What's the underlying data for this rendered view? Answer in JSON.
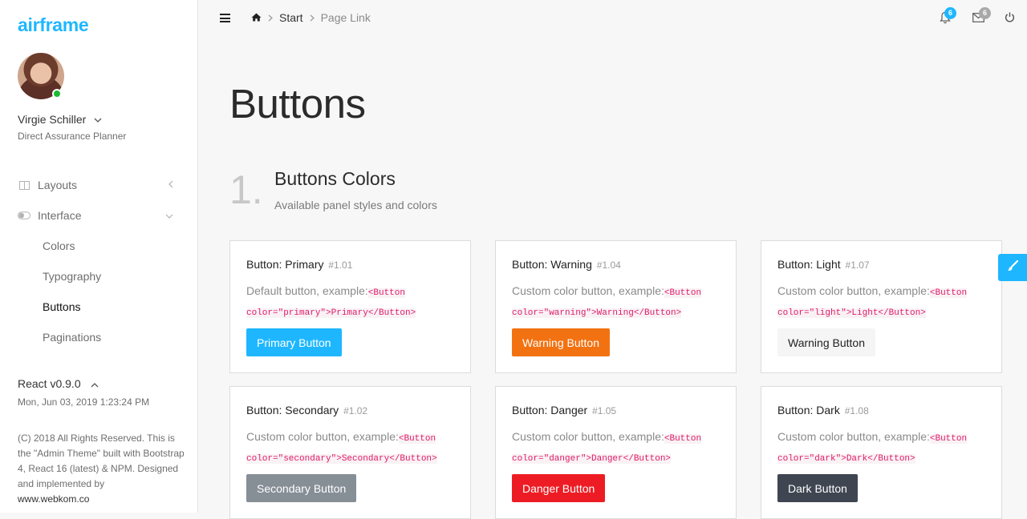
{
  "brand": "airframe",
  "user": {
    "name": "Virgie Schiller",
    "role": "Direct Assurance Planner"
  },
  "sidebar": {
    "items": [
      {
        "label": "Layouts",
        "icon": "columns-icon"
      },
      {
        "label": "Interface",
        "icon": "toggle-icon"
      }
    ],
    "subitems": [
      "Colors",
      "Typography",
      "Buttons",
      "Paginations"
    ],
    "active": "Buttons"
  },
  "footer": {
    "version": "React v0.9.0",
    "datetime": "Mon, Jun 03, 2019 1:23:24 PM",
    "copyright": "(C) 2018 All Rights Reserved. This is the \"Admin Theme\" built with Bootstrap 4, React 16 (latest) & NPM. Designed and implemented by",
    "link": "www.webkom.co"
  },
  "topbar": {
    "breadcrumb_start": "Start",
    "breadcrumb_current": "Page Link",
    "notifications_count": "6",
    "messages_count": "6"
  },
  "page": {
    "title": "Buttons",
    "section_number": "1.",
    "section_title": "Buttons Colors",
    "section_subtitle": "Available panel styles and colors"
  },
  "colors": {
    "primary": "#1EB7FF",
    "warning": "#F27212",
    "light": "#F5F5F5",
    "secondary": "#868E96",
    "danger": "#ED1C24",
    "dark": "#3F4651",
    "online": "#1BB934"
  },
  "cards": [
    {
      "title": "Button: Primary",
      "code": "#1.01",
      "desc": "Default button, example:",
      "snippet": "<Button color=\"primary\">Primary</Button>",
      "button": "Primary Button"
    },
    {
      "title": "Button: Warning",
      "code": "#1.04",
      "desc": "Custom color button, example:",
      "snippet": "<Button color=\"warning\">Warning</Button>",
      "button": "Warning Button"
    },
    {
      "title": "Button: Light",
      "code": "#1.07",
      "desc": "Custom color button, example:",
      "snippet": "<Button color=\"light\">Light</Button>",
      "button": "Warning Button"
    },
    {
      "title": "Button: Secondary",
      "code": "#1.02",
      "desc": "Custom color button, example:",
      "snippet": "<Button color=\"secondary\">Secondary</Button>",
      "button": "Secondary Button"
    },
    {
      "title": "Button: Danger",
      "code": "#1.05",
      "desc": "Custom color button, example:",
      "snippet": "<Button color=\"danger\">Danger</Button>",
      "button": "Danger Button"
    },
    {
      "title": "Button: Dark",
      "code": "#1.08",
      "desc": "Custom color button, example:",
      "snippet": "<Button color=\"dark\">Dark</Button>",
      "button": "Dark Button"
    }
  ]
}
